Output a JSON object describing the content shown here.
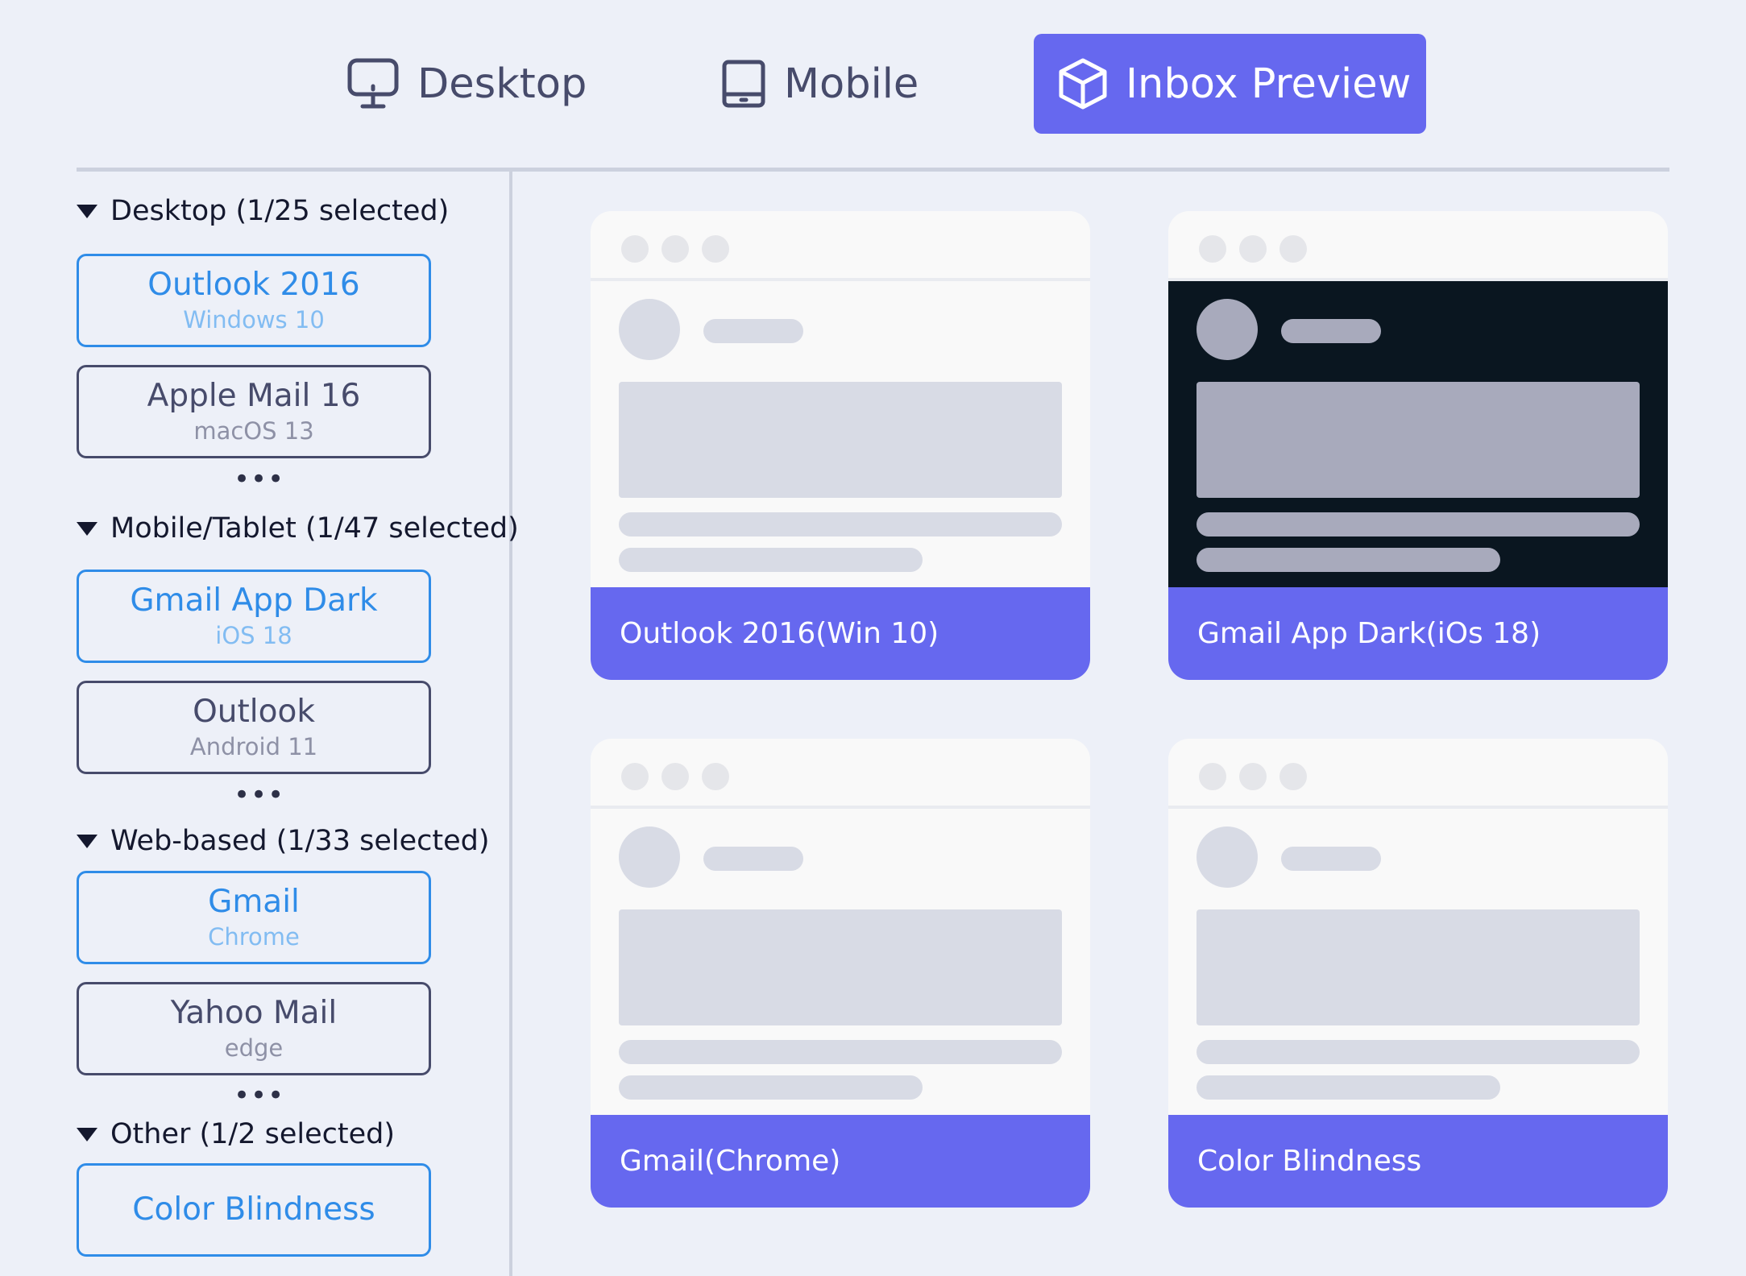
{
  "tabs": {
    "desktop": {
      "label": "Desktop",
      "icon": "monitor-icon"
    },
    "mobile": {
      "label": "Mobile",
      "icon": "tablet-icon"
    },
    "inbox_preview": {
      "label": "Inbox Preview",
      "icon": "cube-icon",
      "active": true
    }
  },
  "sidebar": {
    "groups": [
      {
        "title": "Desktop (1/25 selected)",
        "clients": [
          {
            "name": "Outlook 2016",
            "platform": "Windows 10",
            "selected": true
          },
          {
            "name": "Apple Mail 16",
            "platform": "macOS 13",
            "selected": false
          }
        ],
        "more": "•••"
      },
      {
        "title": "Mobile/Tablet (1/47 selected)",
        "clients": [
          {
            "name": "Gmail App Dark",
            "platform": "iOS 18",
            "selected": true
          },
          {
            "name": "Outlook",
            "platform": "Android 11",
            "selected": false
          }
        ],
        "more": "•••"
      },
      {
        "title": "Web-based (1/33 selected)",
        "clients": [
          {
            "name": "Gmail",
            "platform": "Chrome",
            "selected": true
          },
          {
            "name": "Yahoo Mail",
            "platform": "edge",
            "selected": false
          }
        ],
        "more": "•••"
      },
      {
        "title": "Other (1/2 selected)",
        "clients": [
          {
            "name": "Color Blindness",
            "platform": "",
            "selected": true
          }
        ]
      }
    ]
  },
  "previews": [
    {
      "label": "Outlook 2016(Win 10)",
      "theme": "light"
    },
    {
      "label": "Gmail App Dark(iOs 18)",
      "theme": "dark"
    },
    {
      "label": "Gmail(Chrome)",
      "theme": "light"
    },
    {
      "label": "Color Blindness",
      "theme": "light"
    }
  ],
  "colors": {
    "background": "#edf0f8",
    "accent": "#6668ef",
    "selected_blue": "#2f8ce8",
    "dark_preview": "#0a1620"
  }
}
